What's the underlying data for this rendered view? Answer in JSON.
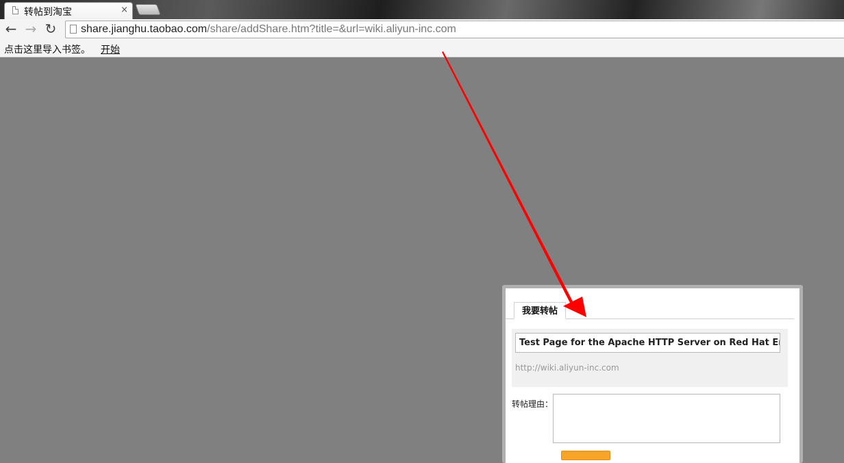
{
  "browser": {
    "tab": {
      "title": "转帖到淘宝",
      "close_label": "×"
    },
    "nav": {
      "back_label": "←",
      "forward_label": "→",
      "reload_label": "↻"
    },
    "address": {
      "host": "share.jianghu.taobao.com",
      "path": "/share/addShare.htm?title=&url=wiki.aliyun-inc.com"
    },
    "bookmarks": {
      "prompt": "点击这里导入书签。",
      "link": "开始"
    }
  },
  "dialog": {
    "tab_label": "我要转帖",
    "title_value": "Test Page for the Apache HTTP Server on Red Hat Enterprise",
    "url_text": "http://wiki.aliyun-inc.com",
    "reason_label": "转帖理由：",
    "reason_value": ""
  },
  "colors": {
    "overlay": "#808080",
    "arrow": "#ff0000",
    "submit_button": "#f7a428"
  }
}
